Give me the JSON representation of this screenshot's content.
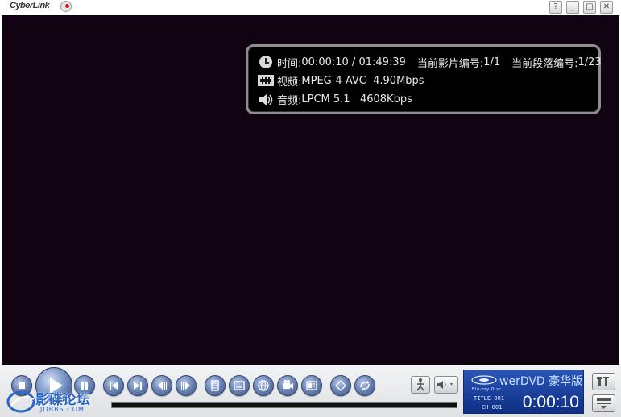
{
  "titlebar": {
    "brand": "CyberLink",
    "buttons": {
      "help": "?",
      "minimize": "_",
      "maximize": "□",
      "close": "✕"
    }
  },
  "osd": {
    "time_label": "时间:",
    "time_current": "00:00:10",
    "time_separator": " / ",
    "time_total": "01:49:39",
    "title_label": "当前影片编号:",
    "title_value": "1/1",
    "chapter_label": "当前段落编号:",
    "chapter_value": "1/23",
    "video_label": "视频:",
    "video_value": "MPEG-4 AVC  4.90Mbps",
    "audio_label": "音频:",
    "audio_value": "LPCM 5.1   4608Kbps"
  },
  "controls": {
    "icons": [
      "stop-icon",
      "play-icon",
      "pause-icon",
      "previous-icon",
      "next-icon",
      "step-back-icon",
      "step-forward-icon",
      "menu-icon",
      "subtitle-icon",
      "language-icon",
      "camera-angle-icon",
      "chapter-icon",
      "zoom-icon",
      "repeat-icon",
      "say-it-again-icon",
      "volume-icon"
    ],
    "progress": 0.0
  },
  "panel": {
    "product": "werDVD 豪华版",
    "bluray_logo": "Blu-ray Disc",
    "title_label": "TITLE",
    "title_value": "001",
    "chapter_label": "CH",
    "chapter_value": "001",
    "time": "0:00:10"
  },
  "watermark": {
    "text": "影碟论坛",
    "sub": "JOBBS.COM"
  },
  "colors": {
    "video_bg": "#120312",
    "panel_blue": "#1a3f9a",
    "button_blue": "#6f88b8"
  }
}
